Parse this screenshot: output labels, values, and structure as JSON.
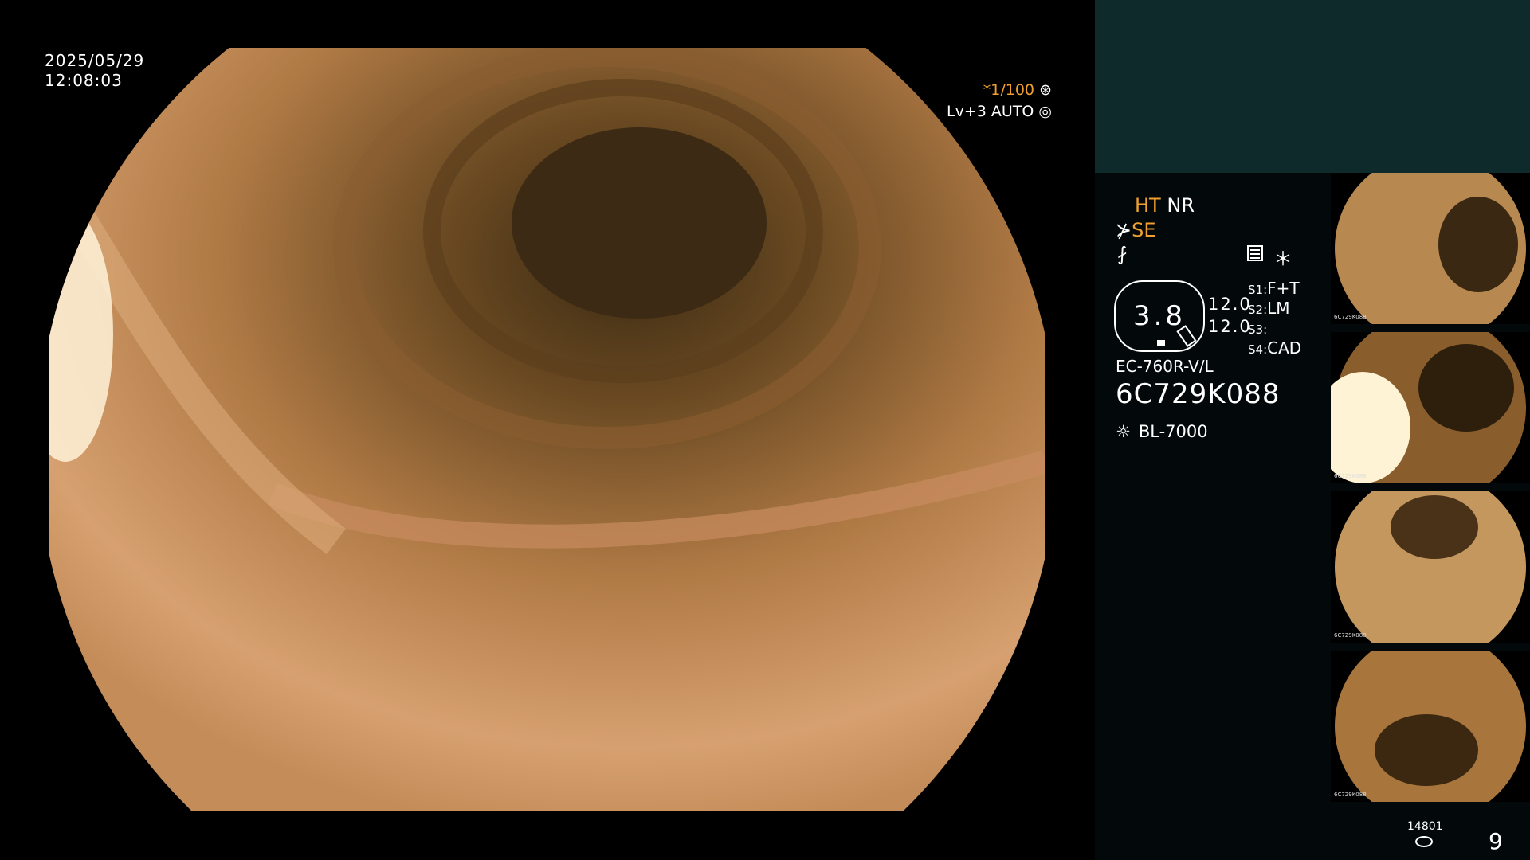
{
  "overlay": {
    "date": "2025/05/29",
    "time": "12:08:03",
    "shutter": "*1/100",
    "level": "Lv+3 AUTO"
  },
  "panel": {
    "mode_ht": "HT",
    "mode_nr": "NR",
    "mode_se": "SE",
    "gauge_value": "3.8",
    "gauge_values": [
      "12.0",
      "12.0"
    ],
    "slots": [
      {
        "key": "S1:",
        "value": "F+T"
      },
      {
        "key": "S2:",
        "value": "LM"
      },
      {
        "key": "S3:",
        "value": ""
      },
      {
        "key": "S4:",
        "value": "CAD"
      }
    ],
    "scope_model": "EC-760R-V/L",
    "serial": "6C729K088",
    "light_source": "BL-7000",
    "counter": "14801",
    "thumb_count": "9"
  },
  "thumbnails": [
    {
      "label": "6C729K088"
    },
    {
      "label": "6C729K088"
    },
    {
      "label": "6C729K088"
    },
    {
      "label": "6C729K088"
    }
  ],
  "colors": {
    "accent": "#f0a030",
    "panel_top": "#0e2a2b",
    "panel_bg": "#03090a"
  },
  "icons": [
    "gear-icon",
    "aperture-icon",
    "scope-icon",
    "equalizer-icon",
    "menu-icon",
    "star-icon",
    "lamp-icon",
    "disk-icon"
  ]
}
